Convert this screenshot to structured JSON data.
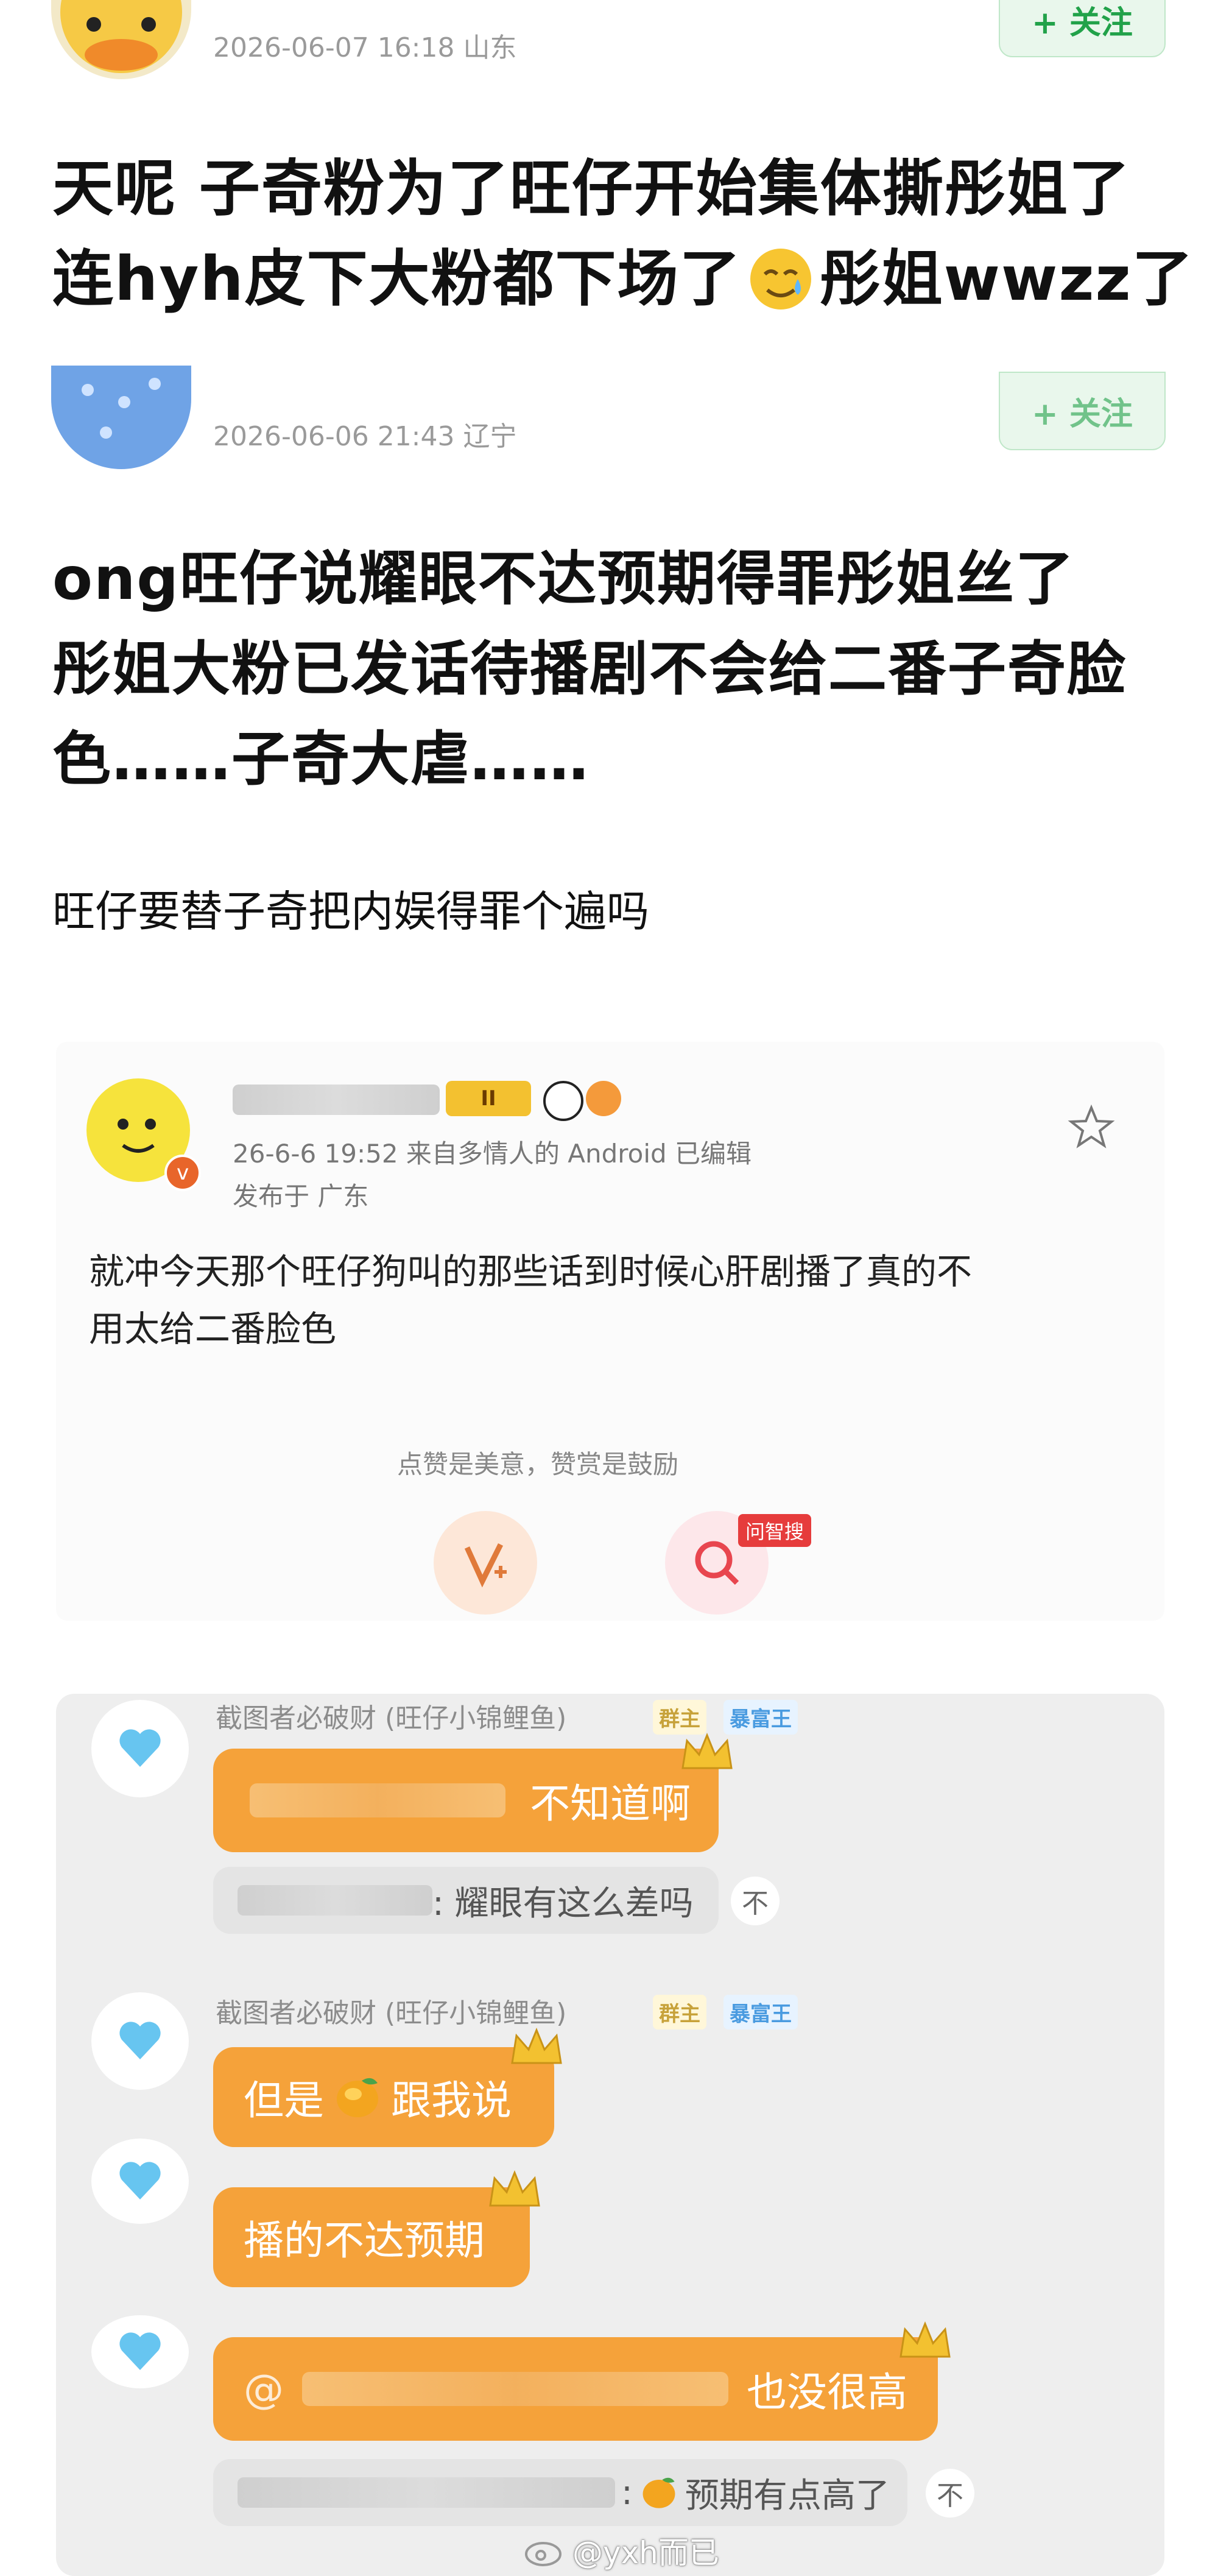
{
  "post1": {
    "meta": "2026-06-07 16:18  山东",
    "follow_label": "+ 关注",
    "title_line1": "天呢 子奇粉为了旺仔开始集体撕彤姐了",
    "title_line2_a": "连hyh皮下大粉都下场了",
    "title_line2_b": "彤姐wwzz了"
  },
  "post2": {
    "meta": "2026-06-06 21:43  辽宁",
    "title_line1": "ong旺仔说耀眼不达预期得罪彤姐丝了",
    "title_line2": "彤姐大粉已发话待播剧不会给二番子奇脸",
    "title_line3": "色……子奇大虐……",
    "body": "旺仔要替子奇把内娱得罪个遍吗"
  },
  "weibo_card": {
    "level_badge": "II",
    "meta_line": "26-6-6 19:52  来自多情人的 Android  已编辑",
    "location": "发布于 广东",
    "body_line1": "就冲今天那个旺仔狗叫的那些话到时候心肝剧播了真的不",
    "body_line2": "用太给二番脸色",
    "reward_hint": "点赞是美意，赞赏是鼓励",
    "search_badge": "问智搜"
  },
  "chat": {
    "sender_name": "截图者必破财 (旺仔小锦鲤鱼)",
    "tag_owner": "群主",
    "tag_rich": "暴富王",
    "messages": [
      {
        "text": "不知道啊"
      },
      {
        "text_a": "但是",
        "text_b": "跟我说"
      },
      {
        "text": "播的不达预期"
      },
      {
        "prefix": "@",
        "text": "也没很高"
      }
    ],
    "quote1": ": 耀眼有这么差吗",
    "quote2": "预期有点高了",
    "quote_close": "不"
  },
  "watermark": "@yxh而已",
  "colors": {
    "follow_green": "#22a24a",
    "bubble_orange": "#f5a23a",
    "chat_bg": "#eeeeee",
    "meta_grey": "#9a9a9a"
  }
}
